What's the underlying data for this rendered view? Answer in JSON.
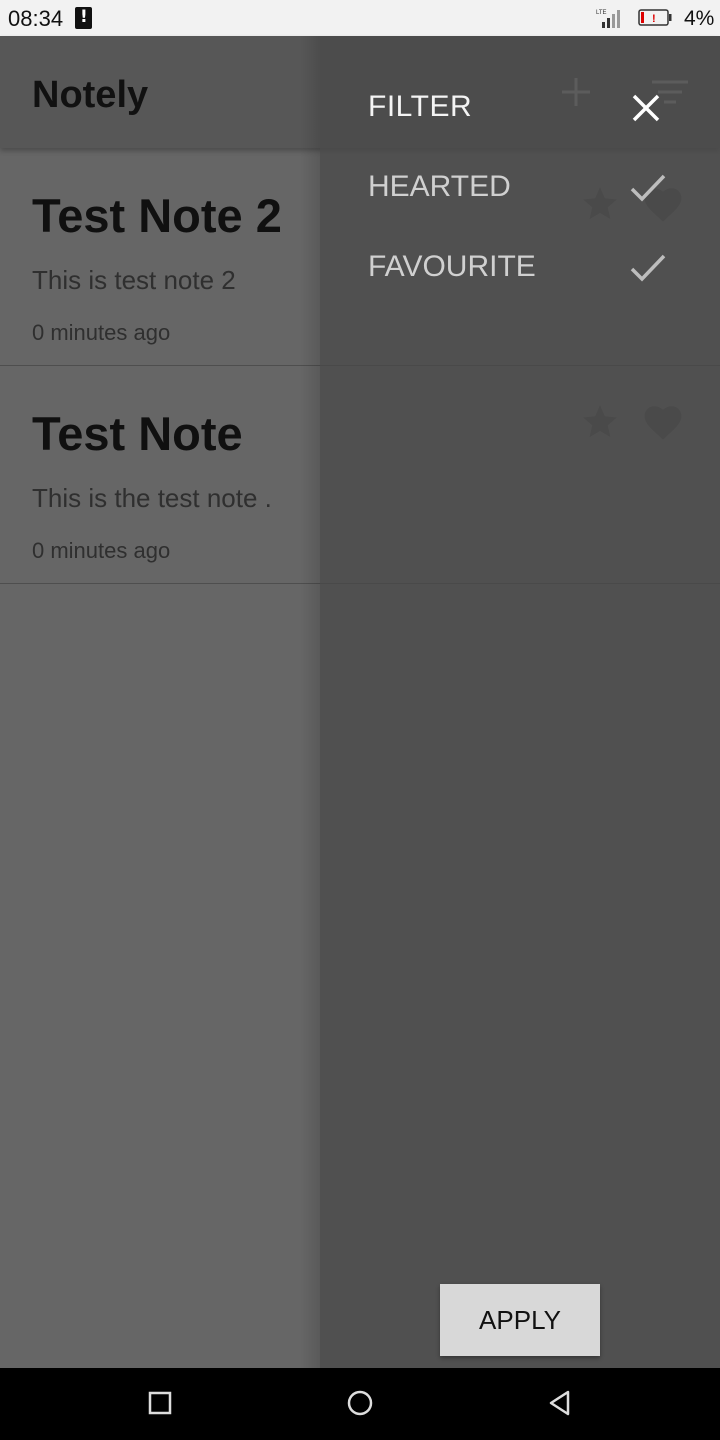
{
  "status_bar": {
    "time": "08:34",
    "battery_percent": "4%",
    "icons": [
      "alert-icon",
      "signal-icon",
      "battery-low-icon"
    ]
  },
  "app": {
    "title": "Notely",
    "header_icons": [
      "add-icon",
      "sort-filter-icon"
    ],
    "notes": [
      {
        "title": "Test Note 2",
        "body": "This is test note 2",
        "time": "0 minutes ago"
      },
      {
        "title": "Test Note",
        "body": "This is the test note .",
        "time": "0 minutes ago"
      }
    ]
  },
  "filter_drawer": {
    "title": "FILTER",
    "close_icon": "close-icon",
    "options": [
      {
        "label": "HEARTED",
        "checked": true
      },
      {
        "label": "FAVOURITE",
        "checked": true
      }
    ],
    "apply_label": "APPLY"
  },
  "nav_bar": {
    "icons": [
      "recents-square-icon",
      "home-circle-icon",
      "back-triangle-icon"
    ]
  },
  "colors": {
    "status_bar_bg": "#f2f2f2",
    "scrim": "#666666",
    "drawer_bg": "#545454",
    "drawer_title": "#f4f4f4",
    "apply_button_bg": "#d8d8d8"
  }
}
